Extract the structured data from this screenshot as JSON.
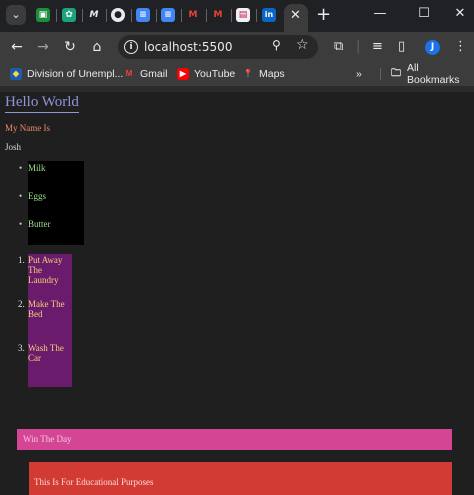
{
  "browser": {
    "url": "localhost:5500",
    "avatar_initial": "J",
    "colors": {
      "frame": "#202124",
      "toolbar": "#3c3c3c",
      "accent": "#1a73e8"
    }
  },
  "bookmarks": [
    {
      "label": "Division of Unempl...",
      "icon": "division-icon"
    },
    {
      "label": "Gmail",
      "icon": "gmail-icon"
    },
    {
      "label": "YouTube",
      "icon": "youtube-icon"
    },
    {
      "label": "Maps",
      "icon": "maps-icon"
    }
  ],
  "bookmarks_overflow": "»",
  "all_bookmarks": "All Bookmarks",
  "page": {
    "heading": "Hello World",
    "subheading": "My Name Is",
    "name": "Josh",
    "unordered_items": [
      "Milk",
      "Eggs",
      "Butter"
    ],
    "ordered_items": [
      {
        "num": "1.",
        "text": "Put Away The Laundry"
      },
      {
        "num": "2.",
        "text": "Make The Bed"
      },
      {
        "num": "3.",
        "text": "Wash The Car"
      }
    ],
    "banner": "Win The Day",
    "footer_note": "This Is For Educational Purposes",
    "colors": {
      "heading": "#8f95d6",
      "subheading": "#ee8866",
      "ul_bg": "#000000",
      "ul_text": "#9ee28f",
      "ol_bg": "#6b1b6b",
      "ol_text": "#f2d27a",
      "banner_bg": "#d44594",
      "footer_bg": "#d23b33"
    }
  }
}
